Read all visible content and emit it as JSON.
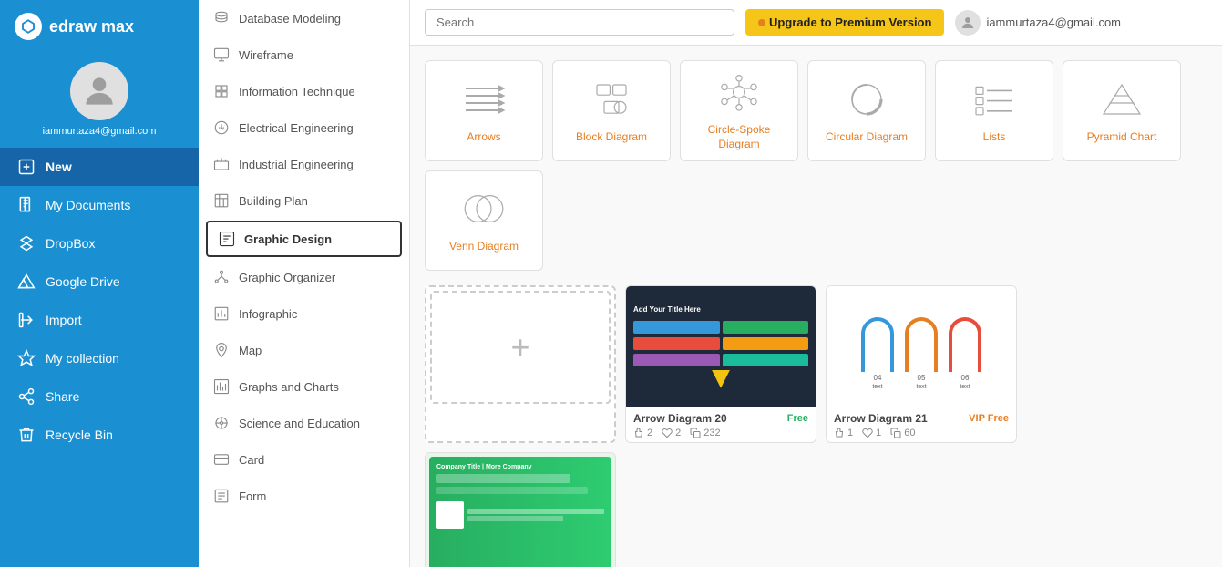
{
  "app": {
    "logo": "D",
    "name": "edraw max"
  },
  "user": {
    "email": "iammurtaza4@gmail.com"
  },
  "sidebar": {
    "items": [
      {
        "id": "new",
        "label": "New",
        "icon": "plus-square"
      },
      {
        "id": "my-documents",
        "label": "My Documents",
        "icon": "file"
      },
      {
        "id": "dropbox",
        "label": "DropBox",
        "icon": "dropbox"
      },
      {
        "id": "google-drive",
        "label": "Google Drive",
        "icon": "drive"
      },
      {
        "id": "import",
        "label": "Import",
        "icon": "login"
      },
      {
        "id": "my-collection",
        "label": "My collection",
        "icon": "star"
      },
      {
        "id": "share",
        "label": "Share",
        "icon": "share"
      },
      {
        "id": "recycle-bin",
        "label": "Recycle Bin",
        "icon": "trash"
      }
    ]
  },
  "middle_panel": {
    "items": [
      {
        "id": "database-modeling",
        "label": "Database Modeling",
        "active": false
      },
      {
        "id": "wireframe",
        "label": "Wireframe",
        "active": false
      },
      {
        "id": "information-technique",
        "label": "Information Technique",
        "active": false
      },
      {
        "id": "electrical-engineering",
        "label": "Electrical Engineering",
        "active": false
      },
      {
        "id": "industrial-engineering",
        "label": "Industrial Engineering",
        "active": false
      },
      {
        "id": "building-plan",
        "label": "Building Plan",
        "active": false
      },
      {
        "id": "graphic-design",
        "label": "Graphic Design",
        "active": true
      },
      {
        "id": "graphic-organizer",
        "label": "Graphic Organizer",
        "active": false
      },
      {
        "id": "infographic",
        "label": "Infographic",
        "active": false
      },
      {
        "id": "map",
        "label": "Map",
        "active": false
      },
      {
        "id": "graphs-and-charts",
        "label": "Graphs and Charts",
        "active": false
      },
      {
        "id": "science-and-education",
        "label": "Science and Education",
        "active": false
      },
      {
        "id": "card",
        "label": "Card",
        "active": false
      },
      {
        "id": "form",
        "label": "Form",
        "active": false
      }
    ]
  },
  "topbar": {
    "search_placeholder": "Search",
    "upgrade_label": "Upgrade to Premium Version",
    "user_email": "iammurtaza4@gmail.com"
  },
  "categories": [
    {
      "id": "arrows",
      "label": "Arrows"
    },
    {
      "id": "block-diagram",
      "label": "Block Diagram"
    },
    {
      "id": "circle-spoke",
      "label": "Circle-Spoke Diagram"
    },
    {
      "id": "circular-diagram",
      "label": "Circular Diagram"
    },
    {
      "id": "lists",
      "label": "Lists"
    },
    {
      "id": "pyramid-chart",
      "label": "Pyramid Chart"
    },
    {
      "id": "venn-diagram",
      "label": "Venn Diagram"
    }
  ],
  "templates": [
    {
      "id": "add-new",
      "type": "add-new",
      "name": "",
      "badge": "",
      "likes": "",
      "hearts": "",
      "copies": ""
    },
    {
      "id": "arrow-diagram-20",
      "type": "arrow-dark",
      "name": "Arrow Diagram 20",
      "badge": "Free",
      "likes": "2",
      "hearts": "2",
      "copies": "232"
    },
    {
      "id": "arrow-diagram-21",
      "type": "arrow-light",
      "name": "Arrow Diagram 21",
      "badge": "VIP Free",
      "likes": "1",
      "hearts": "1",
      "copies": "60"
    },
    {
      "id": "preview-1",
      "type": "preview-green",
      "name": "",
      "badge": "",
      "likes": "",
      "hearts": "",
      "copies": ""
    },
    {
      "id": "preview-2",
      "type": "preview-bottom",
      "name": "",
      "badge": "",
      "likes": "",
      "hearts": "",
      "copies": ""
    }
  ]
}
